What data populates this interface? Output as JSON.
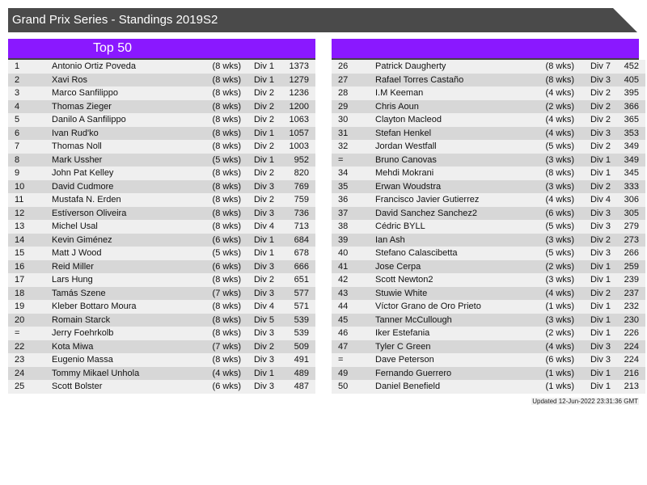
{
  "title": "Grand Prix Series - Standings 2019S2",
  "left_panel": {
    "header": "Top 50"
  },
  "right_panel": {
    "header": ""
  },
  "updated": "Updated 12-Jun-2022 23:31:36 GMT",
  "colors": {
    "title_bg": "#4a4a4a",
    "header_bg": "#8a18ff",
    "row_light": "#efefef",
    "row_dark": "#d7d7d7"
  },
  "standings": [
    {
      "rank": "1",
      "name": "Antonio Ortiz Poveda",
      "weeks": "(8 wks)",
      "div": "Div 1",
      "points": "1373"
    },
    {
      "rank": "2",
      "name": "Xavi Ros",
      "weeks": "(8 wks)",
      "div": "Div 1",
      "points": "1279"
    },
    {
      "rank": "3",
      "name": "Marco Sanfilippo",
      "weeks": "(8 wks)",
      "div": "Div 2",
      "points": "1236"
    },
    {
      "rank": "4",
      "name": "Thomas Zieger",
      "weeks": "(8 wks)",
      "div": "Div 2",
      "points": "1200"
    },
    {
      "rank": "5",
      "name": "Danilo A Sanfilippo",
      "weeks": "(8 wks)",
      "div": "Div 2",
      "points": "1063"
    },
    {
      "rank": "6",
      "name": "Ivan Rud'ko",
      "weeks": "(8 wks)",
      "div": "Div 1",
      "points": "1057"
    },
    {
      "rank": "7",
      "name": "Thomas Noll",
      "weeks": "(8 wks)",
      "div": "Div 2",
      "points": "1003"
    },
    {
      "rank": "8",
      "name": "Mark Ussher",
      "weeks": "(5 wks)",
      "div": "Div 1",
      "points": "952"
    },
    {
      "rank": "9",
      "name": "John Pat Kelley",
      "weeks": "(8 wks)",
      "div": "Div 2",
      "points": "820"
    },
    {
      "rank": "10",
      "name": "David Cudmore",
      "weeks": "(8 wks)",
      "div": "Div 3",
      "points": "769"
    },
    {
      "rank": "11",
      "name": "Mustafa N. Erden",
      "weeks": "(8 wks)",
      "div": "Div 2",
      "points": "759"
    },
    {
      "rank": "12",
      "name": "Estíverson Oliveira",
      "weeks": "(8 wks)",
      "div": "Div 3",
      "points": "736"
    },
    {
      "rank": "13",
      "name": "Michel Usal",
      "weeks": "(8 wks)",
      "div": "Div 4",
      "points": "713"
    },
    {
      "rank": "14",
      "name": "Kevin Giménez",
      "weeks": "(6 wks)",
      "div": "Div 1",
      "points": "684"
    },
    {
      "rank": "15",
      "name": "Matt J Wood",
      "weeks": "(5 wks)",
      "div": "Div 1",
      "points": "678"
    },
    {
      "rank": "16",
      "name": "Reid Miller",
      "weeks": "(6 wks)",
      "div": "Div 3",
      "points": "666"
    },
    {
      "rank": "17",
      "name": "Lars Hung",
      "weeks": "(8 wks)",
      "div": "Div 2",
      "points": "651"
    },
    {
      "rank": "18",
      "name": "Tamás Szene",
      "weeks": "(7 wks)",
      "div": "Div 3",
      "points": "577"
    },
    {
      "rank": "19",
      "name": "Kleber Bottaro Moura",
      "weeks": "(8 wks)",
      "div": "Div 4",
      "points": "571"
    },
    {
      "rank": "20",
      "name": "Romain Starck",
      "weeks": "(8 wks)",
      "div": "Div 5",
      "points": "539"
    },
    {
      "rank": "=",
      "name": "Jerry Foehrkolb",
      "weeks": "(8 wks)",
      "div": "Div 3",
      "points": "539"
    },
    {
      "rank": "22",
      "name": "Kota Miwa",
      "weeks": "(7 wks)",
      "div": "Div 2",
      "points": "509"
    },
    {
      "rank": "23",
      "name": "Eugenio Massa",
      "weeks": "(8 wks)",
      "div": "Div 3",
      "points": "491"
    },
    {
      "rank": "24",
      "name": "Tommy Mikael Unhola",
      "weeks": "(4 wks)",
      "div": "Div 1",
      "points": "489"
    },
    {
      "rank": "25",
      "name": "Scott Bolster",
      "weeks": "(6 wks)",
      "div": "Div 3",
      "points": "487"
    },
    {
      "rank": "26",
      "name": "Patrick Daugherty",
      "weeks": "(8 wks)",
      "div": "Div 7",
      "points": "452"
    },
    {
      "rank": "27",
      "name": "Rafael Torres Castaño",
      "weeks": "(8 wks)",
      "div": "Div 3",
      "points": "405"
    },
    {
      "rank": "28",
      "name": "I.M Keeman",
      "weeks": "(4 wks)",
      "div": "Div 2",
      "points": "395"
    },
    {
      "rank": "29",
      "name": "Chris Aoun",
      "weeks": "(2 wks)",
      "div": "Div 2",
      "points": "366"
    },
    {
      "rank": "30",
      "name": "Clayton Macleod",
      "weeks": "(4 wks)",
      "div": "Div 2",
      "points": "365"
    },
    {
      "rank": "31",
      "name": "Stefan Henkel",
      "weeks": "(4 wks)",
      "div": "Div 3",
      "points": "353"
    },
    {
      "rank": "32",
      "name": "Jordan Westfall",
      "weeks": "(5 wks)",
      "div": "Div 2",
      "points": "349"
    },
    {
      "rank": "=",
      "name": "Bruno Canovas",
      "weeks": "(3 wks)",
      "div": "Div 1",
      "points": "349"
    },
    {
      "rank": "34",
      "name": "Mehdi Mokrani",
      "weeks": "(8 wks)",
      "div": "Div 1",
      "points": "345"
    },
    {
      "rank": "35",
      "name": "Erwan Woudstra",
      "weeks": "(3 wks)",
      "div": "Div 2",
      "points": "333"
    },
    {
      "rank": "36",
      "name": "Francisco Javier Gutierrez",
      "weeks": "(4 wks)",
      "div": "Div 4",
      "points": "306"
    },
    {
      "rank": "37",
      "name": "David Sanchez Sanchez2",
      "weeks": "(6 wks)",
      "div": "Div 3",
      "points": "305"
    },
    {
      "rank": "38",
      "name": "Cédric BYLL",
      "weeks": "(5 wks)",
      "div": "Div 3",
      "points": "279"
    },
    {
      "rank": "39",
      "name": "Ian Ash",
      "weeks": "(3 wks)",
      "div": "Div 2",
      "points": "273"
    },
    {
      "rank": "40",
      "name": "Stefano Calascibetta",
      "weeks": "(5 wks)",
      "div": "Div 3",
      "points": "266"
    },
    {
      "rank": "41",
      "name": "Jose Cerpa",
      "weeks": "(2 wks)",
      "div": "Div 1",
      "points": "259"
    },
    {
      "rank": "42",
      "name": "Scott Newton2",
      "weeks": "(3 wks)",
      "div": "Div 1",
      "points": "239"
    },
    {
      "rank": "43",
      "name": "Stuwie White",
      "weeks": "(4 wks)",
      "div": "Div 2",
      "points": "237"
    },
    {
      "rank": "44",
      "name": "Víctor Grano de Oro Prieto",
      "weeks": "(1 wks)",
      "div": "Div 1",
      "points": "232"
    },
    {
      "rank": "45",
      "name": "Tanner McCullough",
      "weeks": "(3 wks)",
      "div": "Div 1",
      "points": "230"
    },
    {
      "rank": "46",
      "name": "Iker Estefania",
      "weeks": "(2 wks)",
      "div": "Div 1",
      "points": "226"
    },
    {
      "rank": "47",
      "name": "Tyler C Green",
      "weeks": "(4 wks)",
      "div": "Div 3",
      "points": "224"
    },
    {
      "rank": "=",
      "name": "Dave Peterson",
      "weeks": "(6 wks)",
      "div": "Div 3",
      "points": "224"
    },
    {
      "rank": "49",
      "name": "Fernando Guerrero",
      "weeks": "(1 wks)",
      "div": "Div 1",
      "points": "216"
    },
    {
      "rank": "50",
      "name": "Daniel Benefield",
      "weeks": "(1 wks)",
      "div": "Div 1",
      "points": "213"
    }
  ]
}
